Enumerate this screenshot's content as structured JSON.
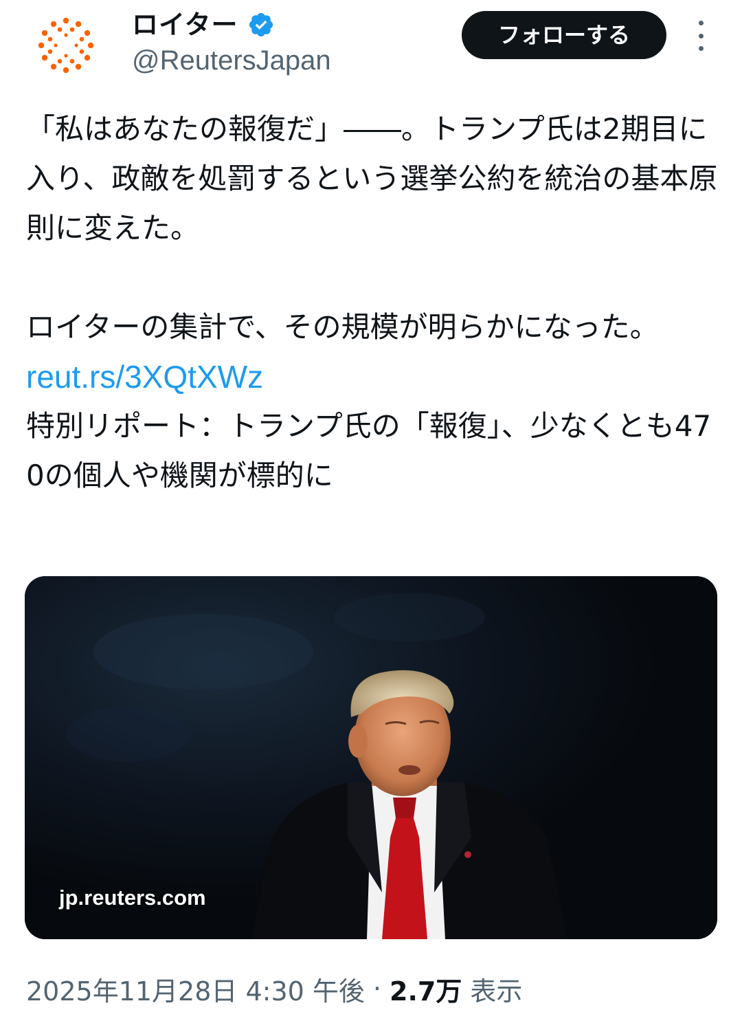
{
  "account": {
    "display_name": "ロイター",
    "handle": "@ReutersJapan",
    "verified": true,
    "avatar_icon": "reuters-logo-icon",
    "verified_icon": "verified-badge-icon",
    "brand_color": "#fa6400"
  },
  "actions": {
    "follow_label": "フォローする",
    "more_icon": "more-vertical-icon"
  },
  "tweet": {
    "paragraph_1": "「私はあなたの報復だ」――。トランプ氏は2期目に入り、政敵を処罰するという選挙公約を統治の基本原則に変えた。",
    "paragraph_2": "ロイターの集計で、その規模が明らかになった。",
    "link": "reut.rs/3XQtXWz",
    "link_color": "#1d9bf0",
    "headline": "特別リポート：トランプ氏の「報復」、少なくとも470の個人や機関が標的に"
  },
  "media": {
    "domain": "jp.reuters.com"
  },
  "meta": {
    "timestamp": "2025年11月28日 4:30 午後",
    "separator": "·",
    "views_count": "2.7万",
    "views_label": "表示"
  }
}
